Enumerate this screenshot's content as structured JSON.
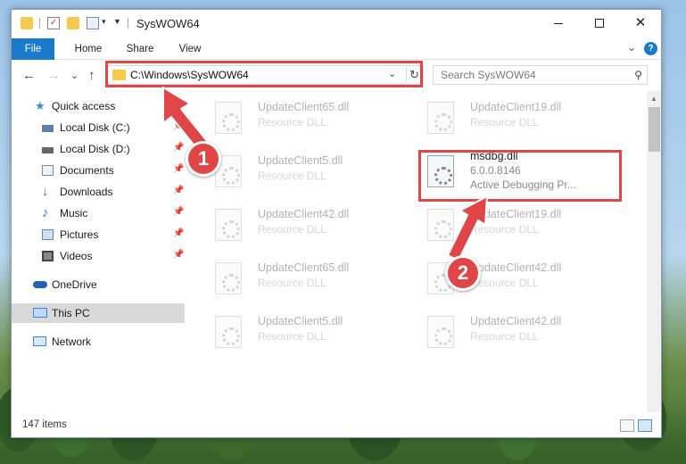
{
  "window": {
    "title": "SysWOW64",
    "minimize_label": "minimize",
    "maximize_label": "maximize",
    "close_glyph": "✕"
  },
  "ribbon": {
    "tabs": [
      "File",
      "Home",
      "Share",
      "View"
    ],
    "expand_glyph": "⌄",
    "help_glyph": "?"
  },
  "navigation": {
    "back_glyph": "←",
    "forward_glyph": "→",
    "recent_glyph": "⌄",
    "up_glyph": "↑",
    "address": "C:\\Windows\\SysWOW64",
    "address_dropdown_glyph": "⌄",
    "refresh_glyph": "↻",
    "search_placeholder": "Search SysWOW64",
    "search_glyph": "⚲"
  },
  "sidebar": {
    "pin_glyph": "📌",
    "items": [
      {
        "label": "Quick access",
        "icon": "star-icon",
        "color": "#3c88d8"
      },
      {
        "label": "Local Disk (C:)",
        "icon": "drive-icon",
        "color": "#5a7fa8"
      },
      {
        "label": "Local Disk (D:)",
        "icon": "drive-icon",
        "color": "#666666"
      },
      {
        "label": "Documents",
        "icon": "documents-icon",
        "color": "#7a8aa0"
      },
      {
        "label": "Downloads",
        "icon": "download-icon",
        "color": "#2a78d0"
      },
      {
        "label": "Music",
        "icon": "music-icon",
        "color": "#2a78d0"
      },
      {
        "label": "Pictures",
        "icon": "pictures-icon",
        "color": "#5a8ab5"
      },
      {
        "label": "Videos",
        "icon": "videos-icon",
        "color": "#444444"
      },
      {
        "label": "OneDrive",
        "icon": "cloud-icon",
        "color": "#1e63b5"
      },
      {
        "label": "This PC",
        "icon": "computer-icon",
        "color": "#3c88d8"
      },
      {
        "label": "Network",
        "icon": "network-icon",
        "color": "#3c88d8"
      }
    ]
  },
  "files": [
    {
      "name": "UpdateClient65.dll",
      "type": "Resource DLL"
    },
    {
      "name": "UpdateClient19.dll",
      "type": "Resource DLL"
    },
    {
      "name": "UpdateClient5.dll",
      "type": "Resource DLL"
    },
    {
      "name": "msdbg.dll",
      "version": "6.0.0.8146",
      "description": "Active Debugging Pr..."
    },
    {
      "name": "UpdateClient42.dll",
      "type": "Resource DLL"
    },
    {
      "name": "UpdateClient19.dll",
      "type": "Resource DLL"
    },
    {
      "name": "UpdateClient65.dll",
      "type": "Resource DLL"
    },
    {
      "name": "UpdateClient42.dll",
      "type": "Resource DLL"
    },
    {
      "name": "UpdateClient5.dll",
      "type": "Resource DLL"
    },
    {
      "name": "UpdateClient42.dll",
      "type": "Resource DLL"
    }
  ],
  "status": {
    "item_count": "147 items"
  },
  "annotations": {
    "step1": "1",
    "step2": "2",
    "highlight_color": "#e04646"
  }
}
